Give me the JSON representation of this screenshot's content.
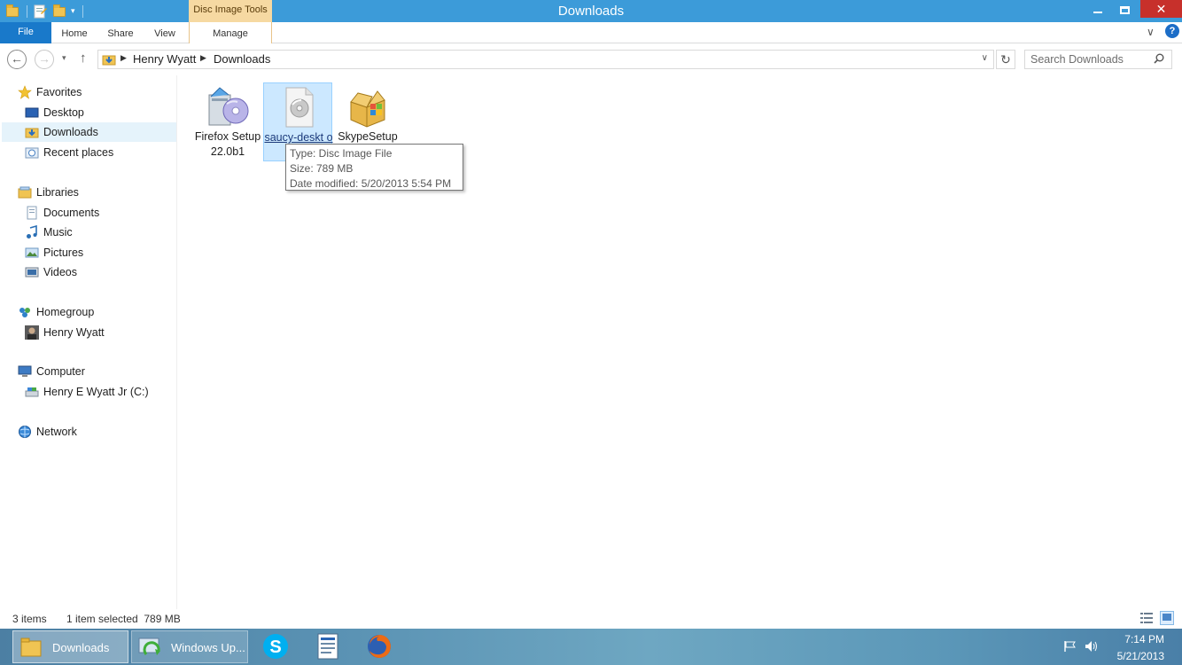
{
  "window": {
    "title": "Downloads",
    "contextual_tab_group": "Disc Image Tools"
  },
  "ribbon": {
    "tabs": [
      {
        "label": "File"
      },
      {
        "label": "Home"
      },
      {
        "label": "Share"
      },
      {
        "label": "View"
      },
      {
        "label": "Manage"
      }
    ],
    "help_label": "?"
  },
  "address_bar": {
    "breadcrumbs": [
      "Henry Wyatt",
      "Downloads"
    ]
  },
  "search": {
    "placeholder": "Search Downloads"
  },
  "nav_pane": {
    "favorites": {
      "label": "Favorites",
      "items": [
        "Desktop",
        "Downloads",
        "Recent places"
      ]
    },
    "libraries": {
      "label": "Libraries",
      "items": [
        "Documents",
        "Music",
        "Pictures",
        "Videos"
      ]
    },
    "homegroup": {
      "label": "Homegroup",
      "items": [
        "Henry Wyatt"
      ]
    },
    "computer": {
      "label": "Computer",
      "items": [
        "Henry E Wyatt Jr (C:)"
      ]
    },
    "network": {
      "label": "Network"
    }
  },
  "files": [
    {
      "name": "Firefox Setup 22.0b1",
      "icon": "installer-disc-icon"
    },
    {
      "name": "saucy-desktop...",
      "name_visible": "saucy-deskt op",
      "icon": "disc-image-file-icon",
      "selected": true
    },
    {
      "name": "SkypeSetup",
      "icon": "installer-box-icon"
    }
  ],
  "tooltip": {
    "type": "Type: Disc Image File",
    "size": "Size: 789 MB",
    "date": "Date modified: 5/20/2013 5:54 PM"
  },
  "status_bar": {
    "item_count": "3 items",
    "selection": "1 item selected  789 MB"
  },
  "taskbar": {
    "buttons": [
      {
        "label": "Downloads",
        "active": true
      },
      {
        "label": "Windows Up..."
      }
    ],
    "pinned": [
      "skype-icon",
      "wordpad-icon",
      "firefox-icon"
    ],
    "clock": {
      "time": "7:14 PM",
      "date": "5/21/2013"
    }
  },
  "colors": {
    "titlebar": "#3c9bd9",
    "file_tab": "#1979ca",
    "contextual": "#f6d9a2",
    "selection": "#cce8ff",
    "close": "#c7302b"
  }
}
